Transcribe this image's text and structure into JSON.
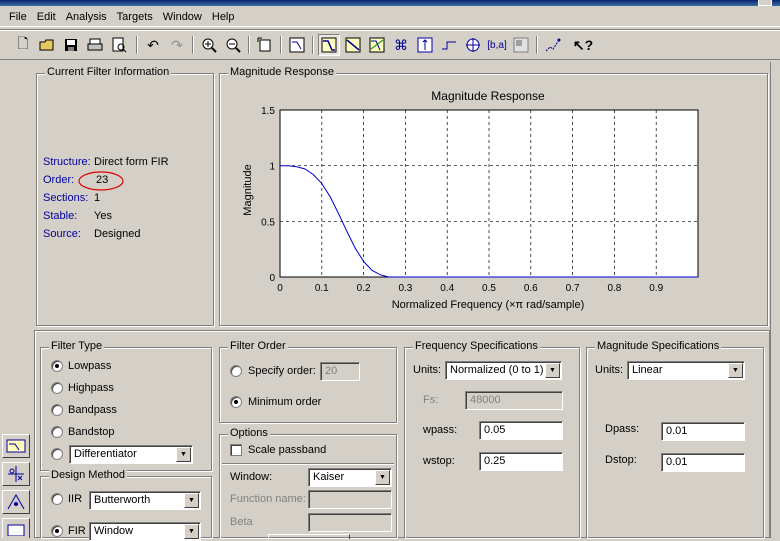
{
  "menu": [
    "File",
    "Edit",
    "Analysis",
    "Targets",
    "Window",
    "Help"
  ],
  "toolbar_icons": [
    "new-icon",
    "open-icon",
    "save-icon",
    "print-icon",
    "print-preview-icon",
    "undo-icon",
    "redo-icon",
    "zoom-in-icon",
    "zoom-out-icon",
    "full-view-icon",
    "filter-manager-icon",
    "magnitude-icon",
    "phase-icon",
    "magnitude-phase-icon",
    "group-delay-icon",
    "impulse-icon",
    "step-icon",
    "pole-zero-icon",
    "coefficients-icon",
    "info-icon",
    "legend-icon",
    "whats-this-icon"
  ],
  "current_filter": {
    "title": "Current Filter Information",
    "rows": [
      {
        "label": "Structure:",
        "value": "Direct form FIR"
      },
      {
        "label": "Order:",
        "value": "23"
      },
      {
        "label": "Sections:",
        "value": "1"
      },
      {
        "label": "Stable:",
        "value": "Yes"
      },
      {
        "label": "Source:",
        "value": "Designed"
      }
    ]
  },
  "magnitude_panel": {
    "title": "Magnitude Response"
  },
  "chart_data": {
    "type": "line",
    "title": "Magnitude Response",
    "xlabel": "Normalized Frequency  (×π rad/sample)",
    "ylabel": "Magnitude",
    "xlim": [
      0,
      1.0
    ],
    "ylim": [
      0,
      1.5
    ],
    "xticks": [
      "0",
      "0.1",
      "0.2",
      "0.3",
      "0.4",
      "0.5",
      "0.6",
      "0.7",
      "0.8",
      "0.9"
    ],
    "yticks": [
      "0",
      "0.5",
      "1",
      "1.5"
    ],
    "grid": true,
    "series": [
      {
        "color": "#0000cc",
        "x": [
          0,
          0.02,
          0.04,
          0.06,
          0.08,
          0.1,
          0.12,
          0.14,
          0.16,
          0.18,
          0.2,
          0.22,
          0.24,
          0.26,
          0.28,
          0.3,
          1.0
        ],
        "y": [
          1.0,
          1.0,
          0.99,
          0.97,
          0.92,
          0.84,
          0.72,
          0.57,
          0.41,
          0.26,
          0.14,
          0.06,
          0.02,
          0.0,
          0.0,
          0.0,
          0.0
        ]
      }
    ]
  },
  "filter_type": {
    "title": "Filter Type",
    "options": [
      "Lowpass",
      "Highpass",
      "Bandpass",
      "Bandstop"
    ],
    "selected": "Lowpass",
    "other_value": "Differentiator"
  },
  "design_method": {
    "title": "Design Method",
    "iir_label": "IIR",
    "iir_value": "Butterworth",
    "fir_label": "FIR",
    "fir_value": "Window"
  },
  "filter_order": {
    "title": "Filter Order",
    "specify_label": "Specify order:",
    "specify_value": "20",
    "minimum_label": "Minimum order"
  },
  "options": {
    "title": "Options",
    "scale_label": "Scale passband",
    "window_label": "Window:",
    "window_value": "Kaiser",
    "function_label": "Function name:",
    "beta_label": "Beta"
  },
  "freq_specs": {
    "title": "Frequency Specifications",
    "units_label": "Units:",
    "units_value": "Normalized (0 to 1)",
    "fs_label": "Fs:",
    "fs_value": "48000",
    "wpass_label": "wpass:",
    "wpass_value": "0.05",
    "wstop_label": "wstop:",
    "wstop_value": "0.25"
  },
  "mag_specs": {
    "title": "Magnitude Specifications",
    "units_label": "Units:",
    "units_value": "Linear",
    "dpass_label": "Dpass:",
    "dpass_value": "0.01",
    "dstop_label": "Dstop:",
    "dstop_value": "0.01"
  },
  "annotation": {
    "color": "#e00000"
  }
}
